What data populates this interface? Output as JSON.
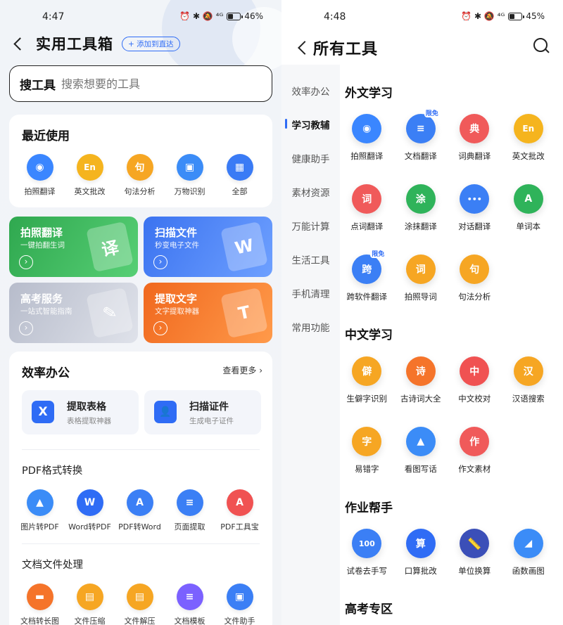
{
  "left": {
    "status": {
      "time": "4:47",
      "icons": "⏰ ✱ 🔕 ⁴ᴳ",
      "battery": "46%"
    },
    "header": {
      "title": "实用工具箱",
      "add_button": "+ 添加到直达"
    },
    "search": {
      "label": "搜工具",
      "placeholder": "搜索想要的工具"
    },
    "recent": {
      "title": "最近使用",
      "items": [
        {
          "label": "拍照翻译",
          "icon": "camera-translate-icon",
          "glyph": "◉",
          "color": "#3a86ff"
        },
        {
          "label": "英文批改",
          "icon": "english-correct-icon",
          "glyph": "En",
          "color": "#f5b41e"
        },
        {
          "label": "句法分析",
          "icon": "syntax-icon",
          "glyph": "句",
          "color": "#f6a623"
        },
        {
          "label": "万物识别",
          "icon": "object-recognition-icon",
          "glyph": "▣",
          "color": "#3b8cf7"
        },
        {
          "label": "全部",
          "icon": "all-grid-icon",
          "glyph": "▦",
          "color": "#3a7bf5"
        }
      ]
    },
    "banners": [
      {
        "title": "拍照翻译",
        "subtitle": "一键拍翻生词",
        "art": "译",
        "color1": "#2fa84f",
        "color2": "#57cf75"
      },
      {
        "title": "扫描文件",
        "subtitle": "秒变电子文件",
        "art": "W",
        "color1": "#3b73f0",
        "color2": "#6ea0ff"
      },
      {
        "title": "高考服务",
        "subtitle": "一站式智能指南",
        "art": "✎",
        "color1": "#b7bccb",
        "color2": "#dfe2ea"
      },
      {
        "title": "提取文字",
        "subtitle": "文字提取神器",
        "art": "T",
        "color1": "#f0681e",
        "color2": "#ff9a4a"
      }
    ],
    "office": {
      "title": "效率办公",
      "more": "查看更多 ›",
      "features": [
        {
          "title": "提取表格",
          "subtitle": "表格提取神器",
          "glyph": "X",
          "color": "#2f6cf5"
        },
        {
          "title": "扫描证件",
          "subtitle": "生成电子证件",
          "glyph": "👤",
          "color": "#2f6cf5"
        }
      ],
      "pdf_title": "PDF格式转换",
      "pdf_items": [
        {
          "label": "图片转PDF",
          "icon": "image-to-pdf-icon",
          "glyph": "▲",
          "color": "#3b8cf7"
        },
        {
          "label": "Word转PDF",
          "icon": "word-to-pdf-icon",
          "glyph": "W",
          "color": "#2f6cf5"
        },
        {
          "label": "PDF转Word",
          "icon": "pdf-to-word-icon",
          "glyph": "A",
          "color": "#3b7ff5"
        },
        {
          "label": "页面提取",
          "icon": "page-extract-icon",
          "glyph": "≡",
          "color": "#3b7ff5"
        },
        {
          "label": "PDF工具宝",
          "icon": "pdf-toolbox-icon",
          "glyph": "A",
          "color": "#f05252"
        }
      ],
      "doc_title": "文档文件处理",
      "doc_items": [
        {
          "label": "文档转长图",
          "icon": "doc-to-image-icon",
          "glyph": "▬",
          "color": "#f5742a"
        },
        {
          "label": "文件压缩",
          "icon": "file-compress-icon",
          "glyph": "▤",
          "color": "#f6a623"
        },
        {
          "label": "文件解压",
          "icon": "file-extract-icon",
          "glyph": "▤",
          "color": "#f6a623"
        },
        {
          "label": "文档模板",
          "icon": "doc-template-icon",
          "glyph": "≡",
          "color": "#7b61ff"
        },
        {
          "label": "文件助手",
          "icon": "file-assistant-icon",
          "glyph": "▣",
          "color": "#3b7ff5"
        }
      ]
    }
  },
  "right": {
    "status": {
      "time": "4:48",
      "icons": "⏰ ✱ 🔕 ⁴ᴳ",
      "battery": "45%"
    },
    "header": {
      "title": "所有工具"
    },
    "nav": [
      "效率办公",
      "学习教辅",
      "健康助手",
      "素材资源",
      "万能计算",
      "生活工具",
      "手机清理",
      "常用功能"
    ],
    "nav_active": "学习教辅",
    "sections": [
      {
        "title": "外文学习",
        "items": [
          {
            "label": "拍照翻译",
            "icon": "photo-translate-icon",
            "glyph": "◉",
            "color": "#3a86ff",
            "tag": ""
          },
          {
            "label": "文档翻译",
            "icon": "doc-translate-icon",
            "glyph": "≡",
            "color": "#3b7ff5",
            "tag": "限免"
          },
          {
            "label": "词典翻译",
            "icon": "dictionary-icon",
            "glyph": "典",
            "color": "#f05a5a",
            "tag": ""
          },
          {
            "label": "英文批改",
            "icon": "english-correct-icon",
            "glyph": "En",
            "color": "#f5b41e",
            "tag": ""
          },
          {
            "label": "点词翻译",
            "icon": "tap-word-icon",
            "glyph": "词",
            "color": "#f05a5a",
            "tag": ""
          },
          {
            "label": "涂抹翻译",
            "icon": "smear-translate-icon",
            "glyph": "涂",
            "color": "#2fb35a",
            "tag": ""
          },
          {
            "label": "对话翻译",
            "icon": "dialog-translate-icon",
            "glyph": "•••",
            "color": "#3b7ff5",
            "tag": ""
          },
          {
            "label": "单词本",
            "icon": "wordbook-icon",
            "glyph": "A",
            "color": "#2fb35a",
            "tag": ""
          },
          {
            "label": "跨软件翻译",
            "icon": "cross-app-translate-icon",
            "glyph": "跨",
            "color": "#3b7ff5",
            "tag": "限免"
          },
          {
            "label": "拍照导词",
            "icon": "photo-words-icon",
            "glyph": "词",
            "color": "#f6a623",
            "tag": ""
          },
          {
            "label": "句法分析",
            "icon": "syntax-icon",
            "glyph": "句",
            "color": "#f6a623",
            "tag": ""
          }
        ]
      },
      {
        "title": "中文学习",
        "items": [
          {
            "label": "生僻字识别",
            "icon": "rare-char-icon",
            "glyph": "僻",
            "color": "#f6a623",
            "tag": ""
          },
          {
            "label": "古诗词大全",
            "icon": "poetry-icon",
            "glyph": "诗",
            "color": "#f5742a",
            "tag": ""
          },
          {
            "label": "中文校对",
            "icon": "proofread-icon",
            "glyph": "中",
            "color": "#f05252",
            "tag": ""
          },
          {
            "label": "汉语搜索",
            "icon": "chinese-search-icon",
            "glyph": "汉",
            "color": "#f6a623",
            "tag": ""
          },
          {
            "label": "易错字",
            "icon": "typo-char-icon",
            "glyph": "字",
            "color": "#f6a623",
            "tag": ""
          },
          {
            "label": "看图写话",
            "icon": "picture-writing-icon",
            "glyph": "▲",
            "color": "#3b8cf7",
            "tag": ""
          },
          {
            "label": "作文素材",
            "icon": "essay-material-icon",
            "glyph": "作",
            "color": "#f05a5a",
            "tag": ""
          }
        ]
      },
      {
        "title": "作业帮手",
        "items": [
          {
            "label": "试卷去手写",
            "icon": "remove-handwriting-icon",
            "glyph": "100",
            "color": "#3b7ff5",
            "tag": ""
          },
          {
            "label": "口算批改",
            "icon": "math-check-icon",
            "glyph": "算",
            "color": "#2f6cf5",
            "tag": ""
          },
          {
            "label": "单位换算",
            "icon": "unit-convert-icon",
            "glyph": "📏",
            "color": "#3b4fb8",
            "tag": ""
          },
          {
            "label": "函数画图",
            "icon": "function-plot-icon",
            "glyph": "◢",
            "color": "#3b8cf7",
            "tag": ""
          }
        ]
      },
      {
        "title": "高考专区",
        "items": []
      }
    ]
  }
}
